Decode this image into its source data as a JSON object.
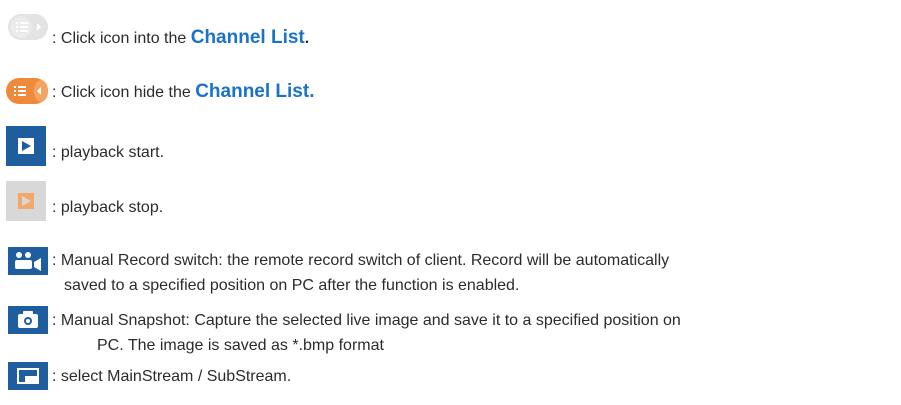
{
  "items": [
    {
      "icon": "channel-list-expand-icon",
      "prefix": ": Click icon into the ",
      "highlight": "Channel List",
      "suffix": "."
    },
    {
      "icon": "channel-list-collapse-icon",
      "prefix": ": Click icon hide the ",
      "highlight": "Channel List."
    },
    {
      "icon": "play-icon",
      "text": ": playback start."
    },
    {
      "icon": "play-disabled-icon",
      "text": ": playback stop."
    },
    {
      "icon": "record-icon",
      "line1": ": Manual Record switch: the remote record switch of client. Record will be automatically",
      "line2": "saved to a specified position on PC after the function is enabled."
    },
    {
      "icon": "camera-icon",
      "line1": ": Manual Snapshot: Capture the selected live image and save it to a specified position on",
      "line2": "PC. The image is saved as *.bmp format"
    },
    {
      "icon": "stream-icon",
      "text": ": select MainStream / SubStream."
    }
  ],
  "colors": {
    "accent_blue": "#1a73c9",
    "icon_blue": "#1f5e9e",
    "icon_orange": "#f08a3b",
    "icon_gray": "#d9d9d9"
  }
}
